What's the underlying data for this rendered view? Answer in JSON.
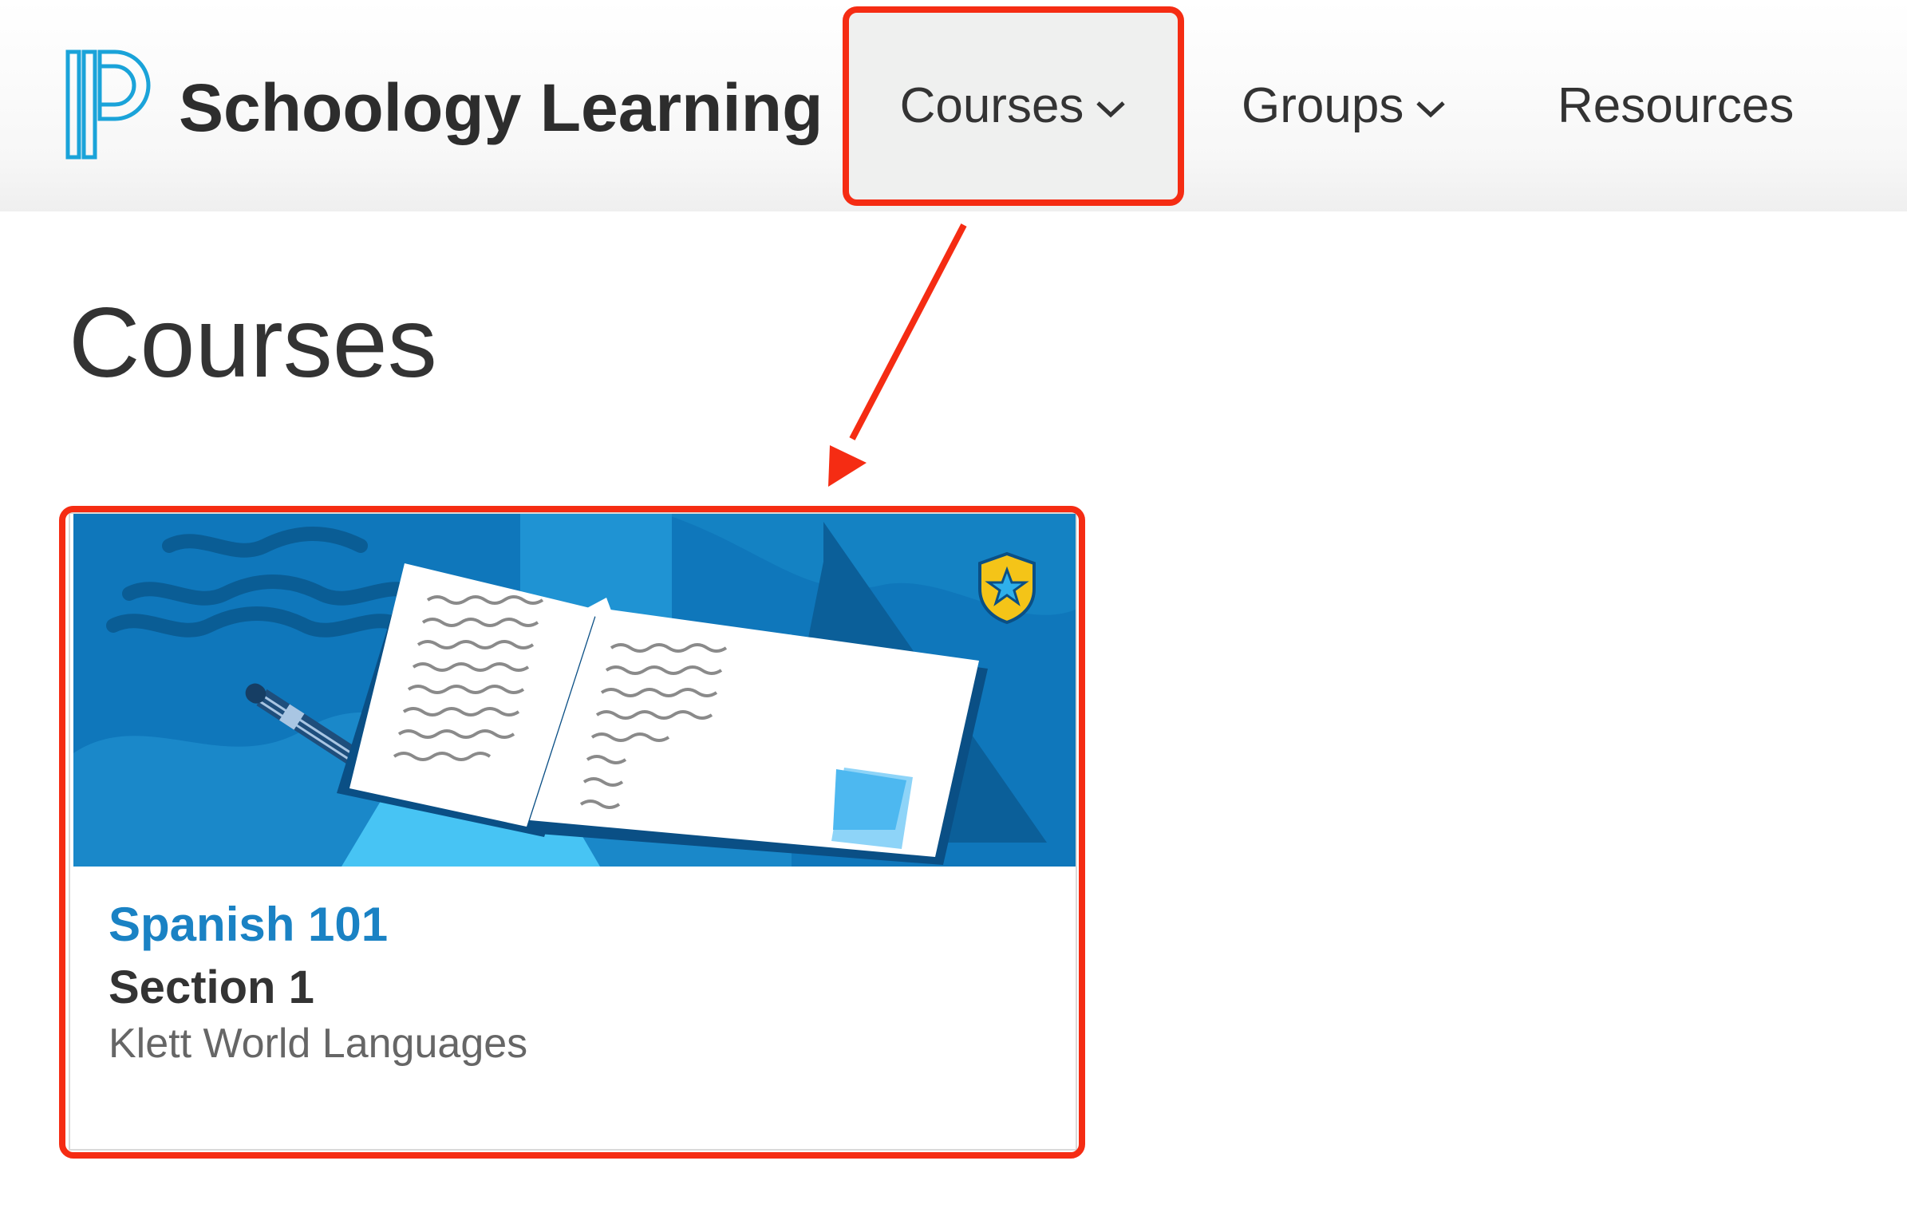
{
  "header": {
    "brand_name": "Schoology Learning",
    "logo_icon": "powerschool-logo-icon",
    "nav": [
      {
        "label": "Courses",
        "has_dropdown": true,
        "active": true
      },
      {
        "label": "Groups",
        "has_dropdown": true,
        "active": false
      },
      {
        "label": "Resources",
        "has_dropdown": false,
        "active": false
      }
    ]
  },
  "main": {
    "page_title": "Courses",
    "courses": [
      {
        "title": "Spanish 101",
        "section": "Section 1",
        "organization": "Klett World Languages",
        "badge_icon": "shield-star-icon"
      }
    ]
  },
  "annotations": {
    "highlight_color": "#f52c13",
    "callouts": [
      "courses-nav-highlight",
      "course-card-highlight",
      "pointer-arrow"
    ]
  },
  "colors": {
    "brand_blue": "#1a9fd6",
    "link_blue": "#1a82c4",
    "text_dark": "#333333",
    "text_muted": "#666666",
    "nav_active_bg": "#eff0ef",
    "card_image_bg": "#0f77bb"
  }
}
